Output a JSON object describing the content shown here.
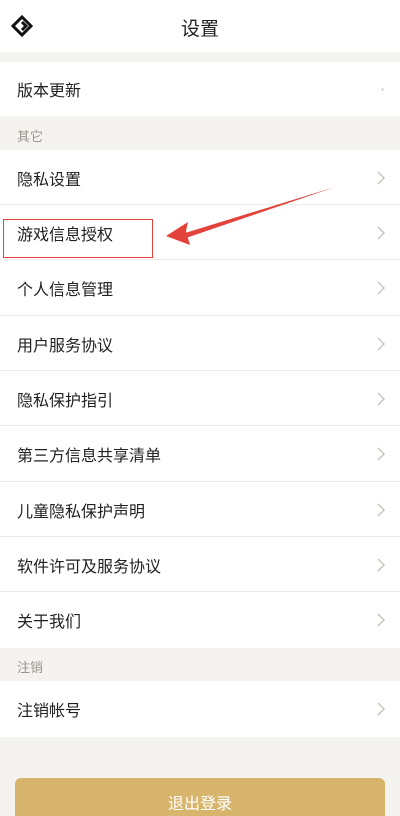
{
  "header": {
    "title": "设置"
  },
  "rows": {
    "version_update": "版本更新",
    "privacy_settings": "隐私设置",
    "game_info_auth": "游戏信息授权",
    "personal_info": "个人信息管理",
    "user_agreement": "用户服务协议",
    "privacy_guide": "隐私保护指引",
    "third_party_list": "第三方信息共享清单",
    "child_privacy": "儿童隐私保护声明",
    "software_license": "软件许可及服务协议",
    "about_us": "关于我们",
    "cancel_account": "注销帐号"
  },
  "sections": {
    "other": "其它",
    "cancel": "注销"
  },
  "footer": {
    "logout_label": "退出登录"
  },
  "colors": {
    "accent": "#d7b56d",
    "annotation": "#e3423a",
    "background": "#f5f3ef"
  }
}
